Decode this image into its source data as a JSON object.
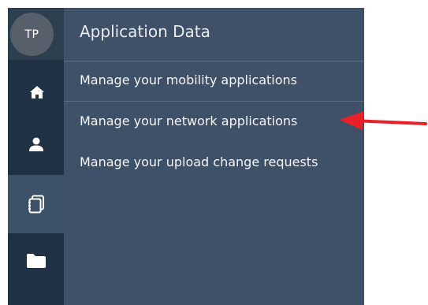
{
  "user": {
    "initials": "TP"
  },
  "rail": {
    "items": [
      {
        "icon": "home-icon"
      },
      {
        "icon": "user-icon"
      },
      {
        "icon": "applications-icon",
        "active": true
      },
      {
        "icon": "folder-icon"
      }
    ]
  },
  "panel": {
    "title": "Application Data",
    "items": [
      {
        "label": "Manage your mobility applications"
      },
      {
        "label": "Manage your network applications"
      },
      {
        "label": "Manage your upload change requests"
      }
    ]
  },
  "colors": {
    "rail": "#1f3142",
    "panel": "#3e5166",
    "active_item": "#3d5166",
    "arrow": "#e8202a"
  }
}
